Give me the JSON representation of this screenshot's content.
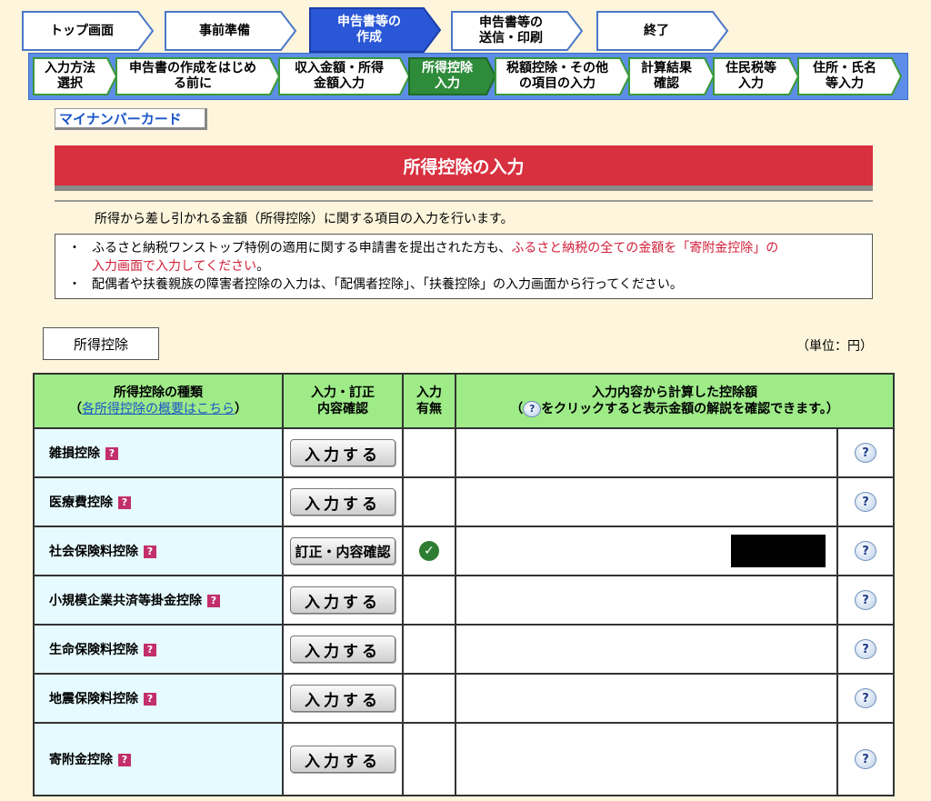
{
  "steps": [
    {
      "label": "トップ画面"
    },
    {
      "label": "事前準備"
    },
    {
      "label": "申告書等の\n作成"
    },
    {
      "label": "申告書等の\n送信・印刷"
    },
    {
      "label": "終了"
    }
  ],
  "substeps": [
    {
      "label": "入力方法\n選択"
    },
    {
      "label": "申告書の作成をはじめ\nる前に"
    },
    {
      "label": "収入金額・所得\n金額入力"
    },
    {
      "label": "所得控除\n入力"
    },
    {
      "label": "税額控除・その他\nの項目の入力"
    },
    {
      "label": "計算結果\n確認"
    },
    {
      "label": "住民税等\n入力"
    },
    {
      "label": "住所・氏名\n等入力"
    }
  ],
  "mynumber_card": "マイナンバーカード",
  "page_title": "所得控除の入力",
  "intro": "所得から差し引かれる金額（所得控除）に関する項目の入力を行います。",
  "notes": {
    "bullet": "・",
    "note1_prefix": "ふるさと納税ワンストップ特例の適用に関する申請書を提出された方も、",
    "note1_red_a": "ふるさと納税の全ての金額を「寄附金控除」の",
    "note1_red_b": "入力画面で入力してください",
    "note1_suffix": "。",
    "note2": "配偶者や扶養親族の障害者控除の入力は、「配偶者控除」、「扶養控除」の入力画面から行ってください。"
  },
  "section_tab": "所得控除",
  "unit": "（単位：円）",
  "table": {
    "col1_title": "所得控除の種類",
    "col1_link": "各所得控除の概要はこちら",
    "col2_a": "入力・訂正",
    "col2_b": "内容確認",
    "col3_a": "入力",
    "col3_b": "有無",
    "col4_a": "入力内容から計算した控除額",
    "col4_b_pre": "（",
    "col4_b_post": "をクリックすると表示金額の解説を確認できます。）",
    "rows": [
      {
        "name": "雑損控除",
        "button": "入力する",
        "entered": false
      },
      {
        "name": "医療費控除",
        "button": "入力する",
        "entered": false
      },
      {
        "name": "社会保険料控除",
        "button": "訂正・内容確認",
        "entered": true
      },
      {
        "name": "小規模企業共済等掛金控除",
        "button": "入力する",
        "entered": false
      },
      {
        "name": "生命保険料控除",
        "button": "入力する",
        "entered": false
      },
      {
        "name": "地震保険料控除",
        "button": "入力する",
        "entered": false
      },
      {
        "name": "寄附金控除",
        "button": "入力する",
        "entered": false
      }
    ]
  },
  "icons": {
    "help": "question-bubble-icon",
    "info": "question-mark-icon",
    "check": "check-icon"
  },
  "colors": {
    "title_red": "#d8303f",
    "header_green": "#9eeb88",
    "active_step": "#2a57d6",
    "active_substep": "#2e8b3a"
  }
}
